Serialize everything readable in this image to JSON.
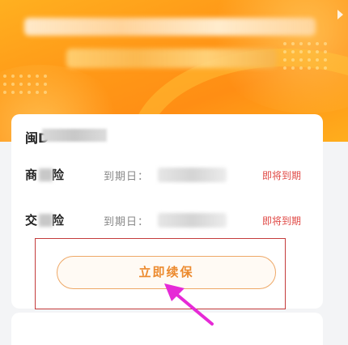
{
  "card": {
    "plate_prefix": "闽D",
    "rows": [
      {
        "name_start": "商",
        "name_end": "险",
        "expiry_label": "到期日：",
        "status": "即将到期"
      },
      {
        "name_start": "交",
        "name_end": "险",
        "expiry_label": "到期日：",
        "status": "即将到期"
      }
    ],
    "renew_button_label": "立即续保"
  },
  "colors": {
    "hero_orange": "#ff9a18",
    "status_red": "#e04a46",
    "button_orange": "#ec8a2e",
    "highlight_red": "#c43c3c",
    "arrow_magenta": "#e62ad6"
  }
}
